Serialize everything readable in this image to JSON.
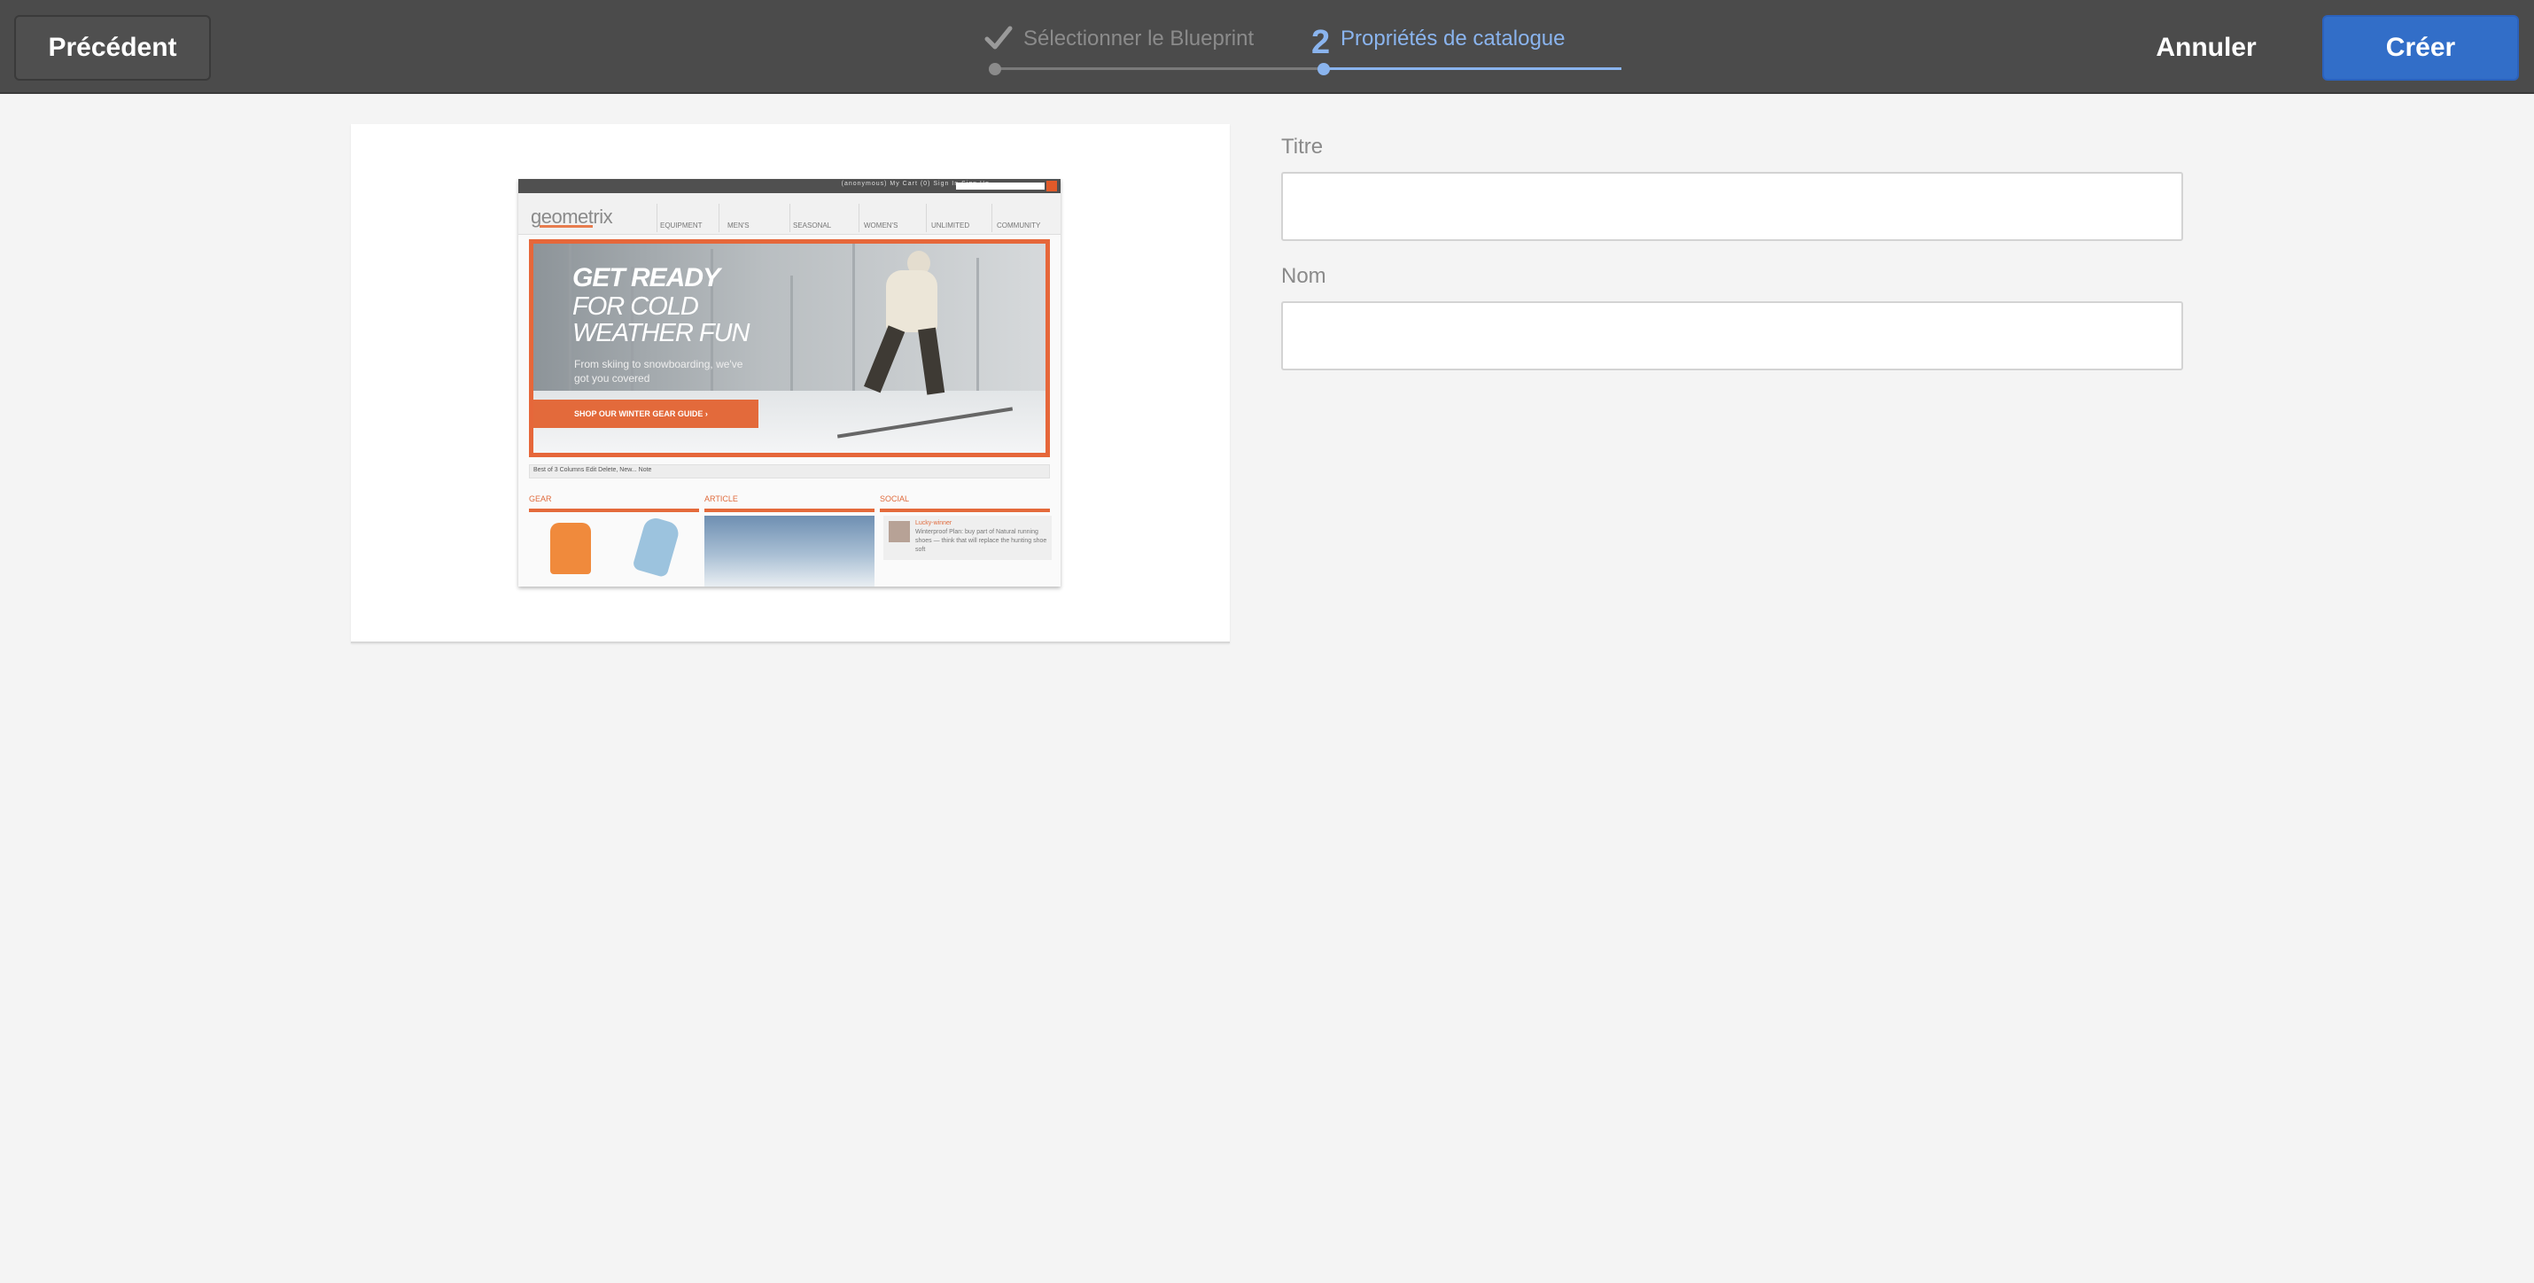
{
  "toolbar": {
    "previous_label": "Précédent",
    "cancel_label": "Annuler",
    "create_label": "Créer",
    "create_color": "#326ec8"
  },
  "wizard": {
    "steps": [
      {
        "number": "",
        "label": "Sélectionner le Blueprint",
        "state": "completed",
        "icon": "checkmark-icon"
      },
      {
        "number": "2",
        "label": "Propriétés de catalogue",
        "state": "active"
      }
    ],
    "active_color": "#8ab4ee",
    "completed_color": "#8b8b8b"
  },
  "preview": {
    "thumbnail_icon": "blueprint-thumbnail",
    "top_links": "(anonymous)   My Cart (0)   Sign In   Sign Up",
    "logo": "geometrix",
    "nav_items": [
      "EQUIPMENT",
      "MEN'S",
      "SEASONAL",
      "WOMEN'S",
      "UNLIMITED",
      "COMMUNITY"
    ],
    "hero_line1": "GET READY",
    "hero_line2": "FOR COLD",
    "hero_line3": "WEATHER FUN",
    "hero_small": "From skiing to snowboarding, we've got you covered",
    "hero_cta": "SHOP OUR WINTER GEAR GUIDE  ›",
    "breadcrumb": "Best of 3 Columns   Edit   Delete, New...   Note",
    "columns": [
      "GEAR",
      "ARTICLE",
      "SOCIAL"
    ],
    "social_name": "Lucky-winner",
    "social_text": "Winterproof Plan: buy part of Natural running shoes — think that will replace the hunting shoe soft"
  },
  "form": {
    "title_label": "Titre",
    "title_value": "",
    "name_label": "Nom",
    "name_value": ""
  }
}
